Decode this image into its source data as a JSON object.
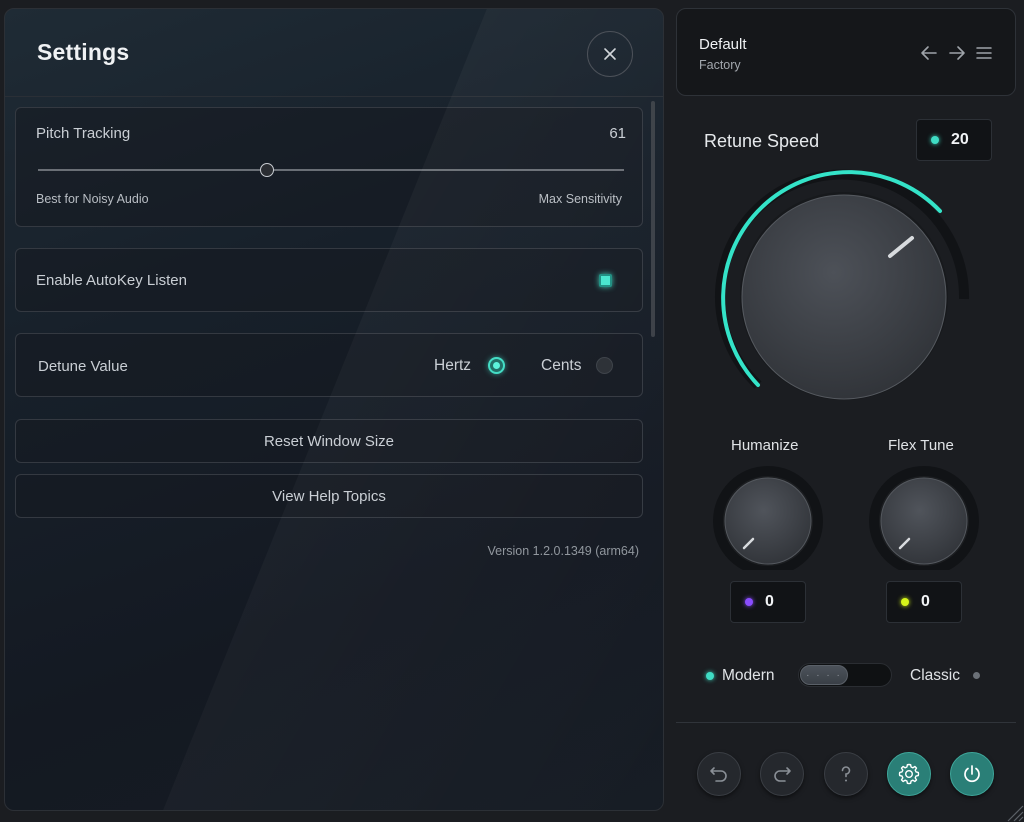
{
  "settings": {
    "title": "Settings",
    "pitch_tracking": {
      "label": "Pitch Tracking",
      "value": "61",
      "slider_fraction": 0.39,
      "min_label": "Best for Noisy Audio",
      "max_label": "Max Sensitivity"
    },
    "autokey": {
      "label": "Enable AutoKey Listen",
      "checked": true
    },
    "detune": {
      "label": "Detune Value",
      "options": [
        {
          "label": "Hertz",
          "selected": true
        },
        {
          "label": "Cents",
          "selected": false
        }
      ]
    },
    "reset_label": "Reset Window Size",
    "help_label": "View Help Topics",
    "version": "Version 1.2.0.1349 (arm64)"
  },
  "preset": {
    "name": "Default",
    "category": "Factory"
  },
  "retune": {
    "label": "Retune Speed",
    "value": "20"
  },
  "humanize": {
    "label": "Humanize",
    "value": "0"
  },
  "flex_tune": {
    "label": "Flex Tune",
    "value": "0"
  },
  "mode": {
    "left_label": "Modern",
    "right_label": "Classic",
    "selected": "Modern"
  },
  "colors": {
    "accent": "#3fdcc4",
    "humanize_dot": "#8a4dff",
    "flex_dot": "#d6f51a",
    "active_button": "#2a7f77"
  },
  "icons": {
    "close": "close-icon",
    "prev": "arrow-left-icon",
    "next": "arrow-right-icon",
    "menu": "menu-icon",
    "undo": "undo-icon",
    "redo": "redo-icon",
    "help": "help-icon",
    "settings": "gear-icon",
    "power": "power-icon"
  }
}
